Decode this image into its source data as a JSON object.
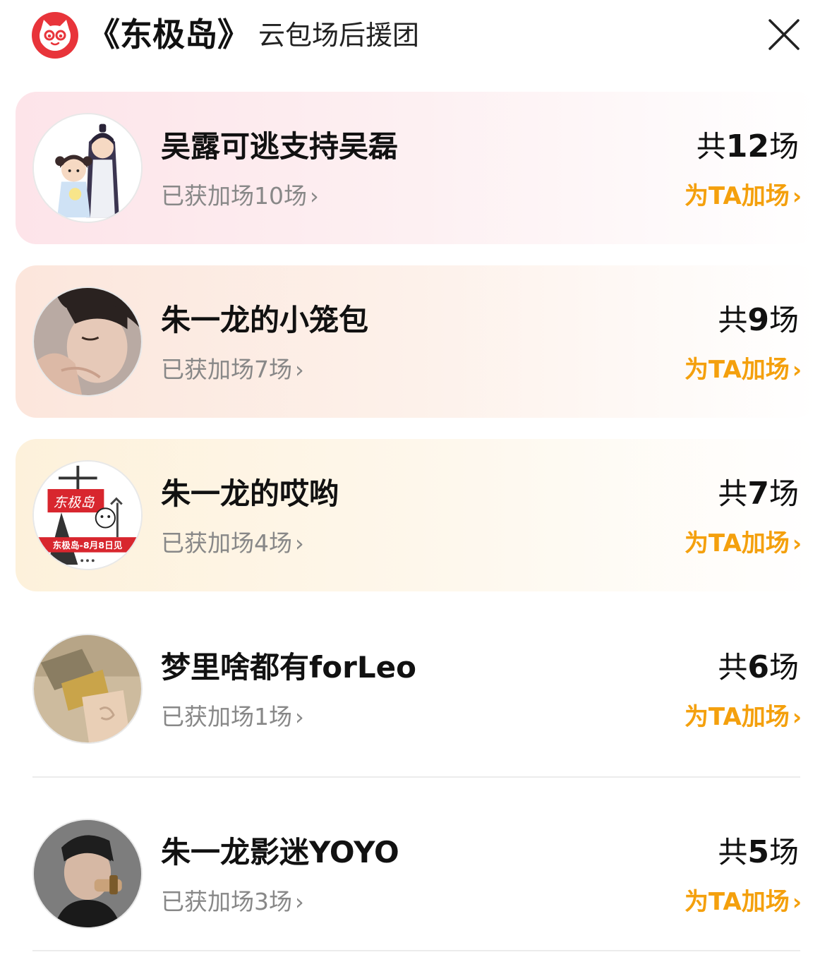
{
  "header": {
    "movie_title": "《东极岛》",
    "subtitle": "云包场后援团",
    "logo_icon": "maoyan-cat-logo-icon",
    "close_icon": "close-icon"
  },
  "colors": {
    "accent": "#f4a00d",
    "logo_red": "#e8343a",
    "secondary_text": "#888888"
  },
  "groups": [
    {
      "name": "吴露可逃支持吴磊",
      "earned": "已获加场10场",
      "total_prefix": "共",
      "total_num": "12",
      "total_suffix": "场",
      "action": "为TA加场"
    },
    {
      "name": "朱一龙的小笼包",
      "earned": "已获加场7场",
      "total_prefix": "共",
      "total_num": "9",
      "total_suffix": "场",
      "action": "为TA加场"
    },
    {
      "name": "朱一龙的哎哟",
      "earned": "已获加场4场",
      "total_prefix": "共",
      "total_num": "7",
      "total_suffix": "场",
      "action": "为TA加场",
      "avatar_text": "东极岛-8月8日见"
    },
    {
      "name": "梦里啥都有forLeo",
      "earned": "已获加场1场",
      "total_prefix": "共",
      "total_num": "6",
      "total_suffix": "场",
      "action": "为TA加场"
    },
    {
      "name": "朱一龙影迷YOYO",
      "earned": "已获加场3场",
      "total_prefix": "共",
      "total_num": "5",
      "total_suffix": "场",
      "action": "为TA加场"
    }
  ],
  "chevron": "›"
}
